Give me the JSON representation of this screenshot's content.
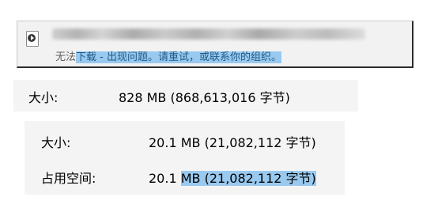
{
  "notification": {
    "icon": "video-file-icon",
    "status_prefix": "无法",
    "status_selected": "下载 - 出现问题。请重试，或联系你的组织。"
  },
  "properties": {
    "first": {
      "label": "大小:",
      "value": "828 MB (868,613,016 字节)"
    },
    "size": {
      "label": "大小:",
      "value": "20.1 MB (21,082,112 字节)"
    },
    "disk": {
      "label": "占用空间:",
      "value_prefix": "20.1 ",
      "value_selected": "MB (21,082,112 字节)"
    }
  },
  "colors": {
    "selection": "#99c9ef",
    "panel_background": "#f4f4f4",
    "notification_background": "#f2f2f2"
  }
}
